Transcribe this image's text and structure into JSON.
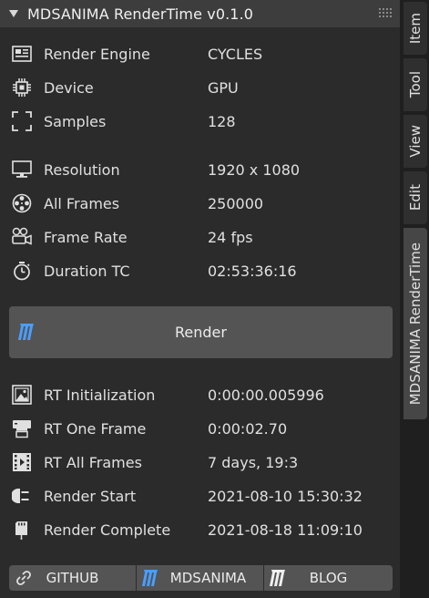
{
  "panel": {
    "title": "MDSANIMA RenderTime v0.1.0"
  },
  "settings": [
    {
      "label": "Render Engine",
      "value": "CYCLES",
      "icon": "render-engine-icon"
    },
    {
      "label": "Device",
      "value": "GPU",
      "icon": "chip-icon"
    },
    {
      "label": "Samples",
      "value": "128",
      "icon": "samples-frame-icon"
    },
    {
      "label": "Resolution",
      "value": "1920 x 1080",
      "icon": "monitor-icon"
    },
    {
      "label": "All Frames",
      "value": "250000",
      "icon": "film-reel-icon"
    },
    {
      "label": "Frame Rate",
      "value": "24 fps",
      "icon": "camera-icon"
    },
    {
      "label": "Duration TC",
      "value": "02:53:36:16",
      "icon": "stopwatch-icon"
    }
  ],
  "render_button": {
    "label": "Render"
  },
  "results": [
    {
      "label": "RT Initialization",
      "value": "0:00:00.005996",
      "icon": "image-icon"
    },
    {
      "label": "RT One Frame",
      "value": "0:00:02.70",
      "icon": "printer-icon"
    },
    {
      "label": "RT All Frames",
      "value": "7 days, 19:3",
      "icon": "film-strip-icon"
    },
    {
      "label": "Render Start",
      "value": "2021-08-10 15:30:32",
      "icon": "plug-icon"
    },
    {
      "label": "Render Complete",
      "value": "2021-08-18 11:09:10",
      "icon": "sd-card-icon"
    }
  ],
  "footer": {
    "github": "GITHUB",
    "mdsanima": "MDSANIMA",
    "blog": "BLOG"
  },
  "tabs": {
    "item": "Item",
    "tool": "Tool",
    "view": "View",
    "edit": "Edit",
    "rendertime": "MDSANIMA RenderTime"
  },
  "colors": {
    "panel_bg": "#2b2b2b",
    "header_bg": "#3d3d3d",
    "button_bg": "#545454",
    "logo_blue": "#4a9eff"
  }
}
